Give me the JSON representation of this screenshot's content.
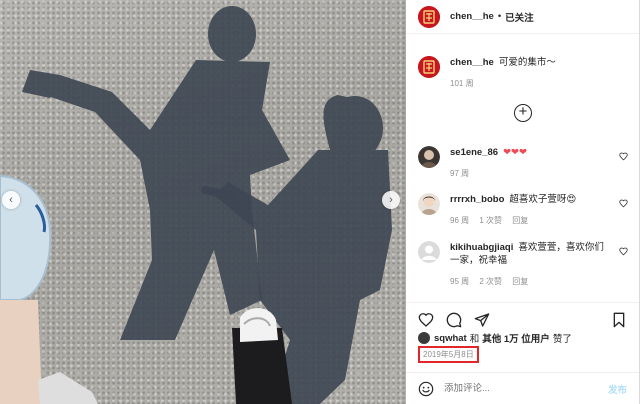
{
  "post": {
    "author": "chen__he",
    "follow_label": "已关注",
    "dot": "•",
    "brand_color": "#c7161d"
  },
  "caption": {
    "username": "chen__he",
    "text": "可爱的集市～",
    "time": "101 周"
  },
  "comments": [
    {
      "username": "se1ene_86",
      "text": "❤❤❤",
      "time": "97 周",
      "likes": "",
      "reply": ""
    },
    {
      "username": "rrrrxh_bobo",
      "text": "超喜欢子萱呀😍",
      "time": "96 周",
      "likes": "1 次赞",
      "reply": "回复"
    },
    {
      "username": "kikihuabgjiaqi",
      "text": "喜欢萱萱，喜欢你们一家，祝幸福",
      "time": "95 周",
      "likes": "2 次赞",
      "reply": "回复"
    }
  ],
  "likes": {
    "user": "sqwhat",
    "connector": "和",
    "others": "其他 1万 位用户",
    "suffix": "赞了"
  },
  "date": "2019年5月8日",
  "add_comment": {
    "placeholder": "添加评论...",
    "post_label": "发布"
  },
  "carousel": {
    "prev": "‹",
    "next": "›"
  },
  "load_more": "+"
}
